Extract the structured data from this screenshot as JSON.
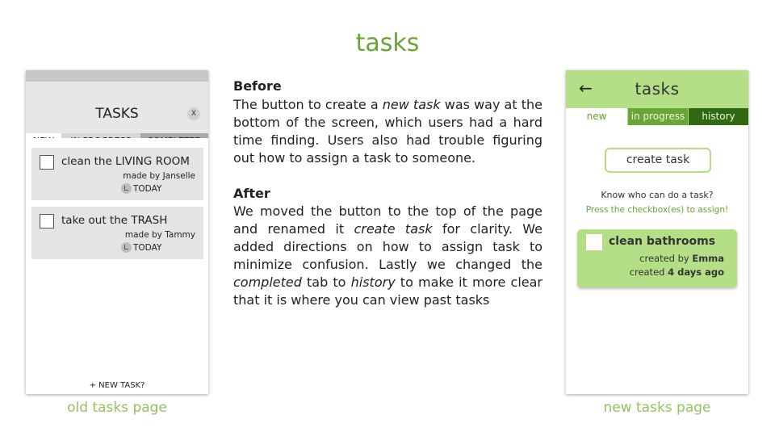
{
  "slide_title": "tasks",
  "old_page": {
    "title": "TASKS",
    "close_label": "X",
    "tabs": [
      "NEW",
      "IN PROGRESS",
      "COMPLETED"
    ],
    "tasks": [
      {
        "title": "clean the LIVING ROOM",
        "made_by": "made by Janselle",
        "when": "TODAY"
      },
      {
        "title": "take out the TRASH",
        "made_by": "made by Tammy",
        "when": "TODAY"
      }
    ],
    "new_task_label": "+ NEW TASK?",
    "caption": "old tasks page"
  },
  "before": {
    "heading": "Before",
    "t1": "The button to create a ",
    "t1_em": "new task",
    "t2": " was way at the bottom of the screen, which users had a hard time finding. Users also had trouble figuring out how to assign a task to someone."
  },
  "after": {
    "heading": "After",
    "t1": "We moved the button to the top of the page and renamed it ",
    "t1_em": "create task",
    "t2": " for clarity. We added directions on how to assign task to minimize confusion. Lastly we changed the ",
    "t2_em": "completed",
    "t3": " tab to ",
    "t3_em": "history",
    "t4": " to make it more clear that it is where you can view past tasks"
  },
  "new_page": {
    "back_icon": "←",
    "title": "tasks",
    "tabs": [
      "new",
      "in progress",
      "history"
    ],
    "create_label": "create task",
    "hint": "Know who can do a task?",
    "instruction": "Press the checkbox(es) to assign!",
    "task": {
      "title": "clean bathrooms",
      "by_prefix": "created by ",
      "by_name": "Emma",
      "when_prefix": "created ",
      "when_value": "4 days ago"
    },
    "caption": "new tasks page"
  },
  "colors": {
    "accent": "#6aa535",
    "light_green": "#b4df86",
    "dark_green": "#2f6a12",
    "caption": "#8fc45f"
  }
}
